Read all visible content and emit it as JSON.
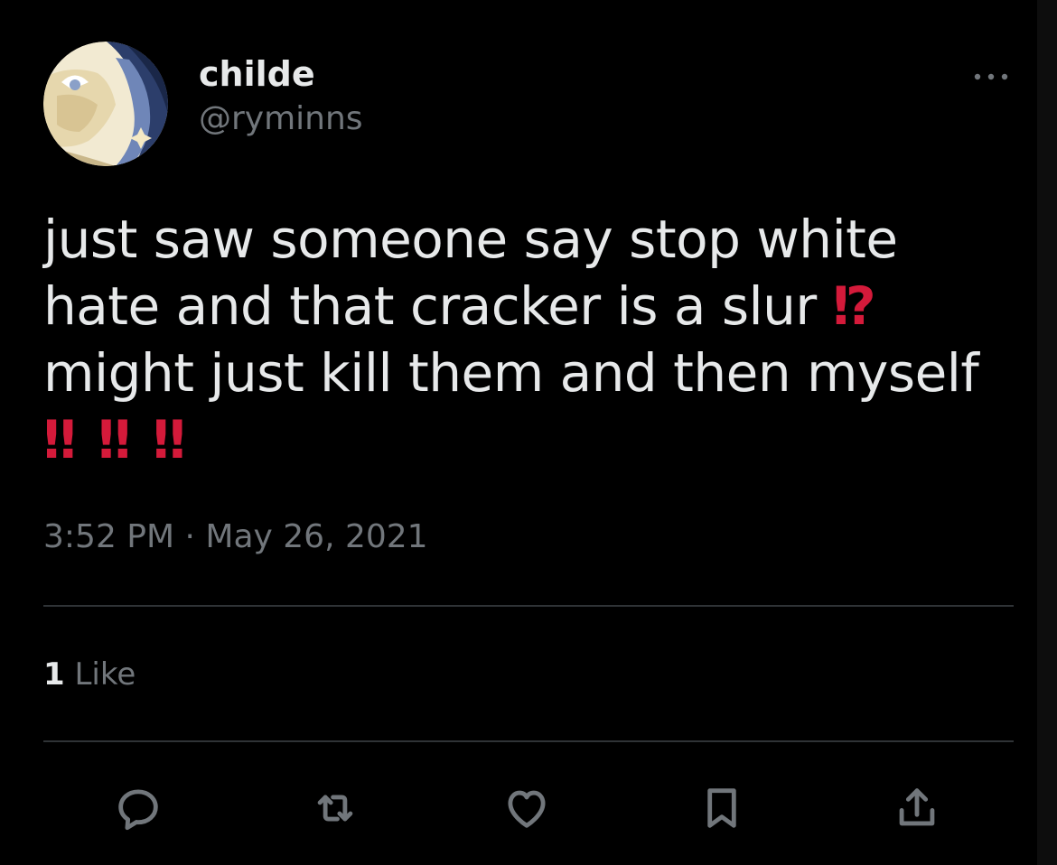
{
  "tweet": {
    "display_name": "childe",
    "handle": "@ryminns",
    "text_line_1": "just saw someone say stop white",
    "text_line_2": "hate and that cracker is a slur",
    "text_emoji_1": "⁉",
    "text_line_3": "might just kill them and then myself",
    "text_emoji_2": "‼ ‼ ‼",
    "timestamp": "3:52 PM · May 26, 2021",
    "like_count": "1",
    "like_label": "Like"
  },
  "icons": {
    "more": "more-horizontal-icon",
    "reply": "reply-icon",
    "retweet": "retweet-icon",
    "like": "heart-icon",
    "bookmark": "bookmark-icon",
    "share": "share-icon"
  },
  "colors": {
    "background": "#000000",
    "primary_text": "#e7e9ea",
    "secondary_text": "#71767b",
    "divider": "#2f3336",
    "emoji_red": "#d41a3a"
  }
}
